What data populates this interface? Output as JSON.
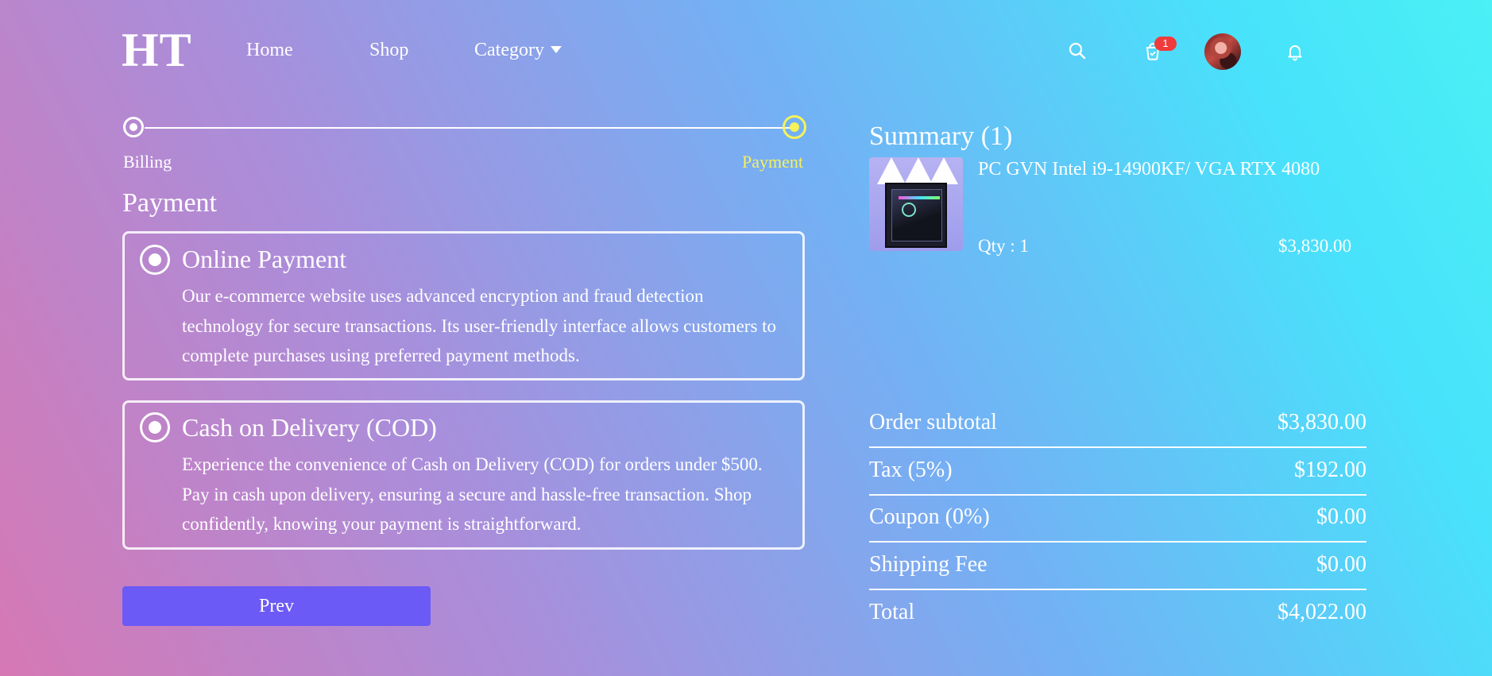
{
  "header": {
    "logo": "HT",
    "nav": {
      "home": "Home",
      "shop": "Shop",
      "category": "Category"
    },
    "cart_count": "1",
    "icons": [
      "search-icon",
      "cart-icon",
      "avatar",
      "bell-icon"
    ]
  },
  "stepper": {
    "steps": [
      {
        "label": "Billing",
        "state": "completed"
      },
      {
        "label": "Payment",
        "state": "active"
      }
    ],
    "active_color": "#f5f25a"
  },
  "payment": {
    "title": "Payment",
    "options": [
      {
        "title": "Online Payment",
        "description": "Our e-commerce website uses advanced encryption and fraud detection technology for secure transactions. Its user-friendly interface allows customers to complete purchases using preferred payment methods."
      },
      {
        "title": "Cash on Delivery (COD)",
        "description": "Experience the convenience of Cash on Delivery (COD) for orders under $500. Pay in cash upon delivery, ensuring a secure and hassle-free transaction. Shop confidently, knowing your payment is straightforward."
      }
    ],
    "prev_label": "Prev",
    "button_color": "#6b5af5"
  },
  "summary": {
    "title": "Summary (1)",
    "items": [
      {
        "name": "PC GVN Intel i9-14900KF/ VGA RTX 4080",
        "qty": "Qty : 1",
        "price": "$3,830.00"
      }
    ],
    "totals": [
      {
        "label": "Order subtotal",
        "value": "$3,830.00"
      },
      {
        "label": "Tax (5%)",
        "value": "$192.00"
      },
      {
        "label": "Coupon (0%)",
        "value": "$0.00"
      },
      {
        "label": "Shipping Fee",
        "value": "$0.00"
      },
      {
        "label": "Total",
        "value": "$4,022.00"
      }
    ]
  }
}
